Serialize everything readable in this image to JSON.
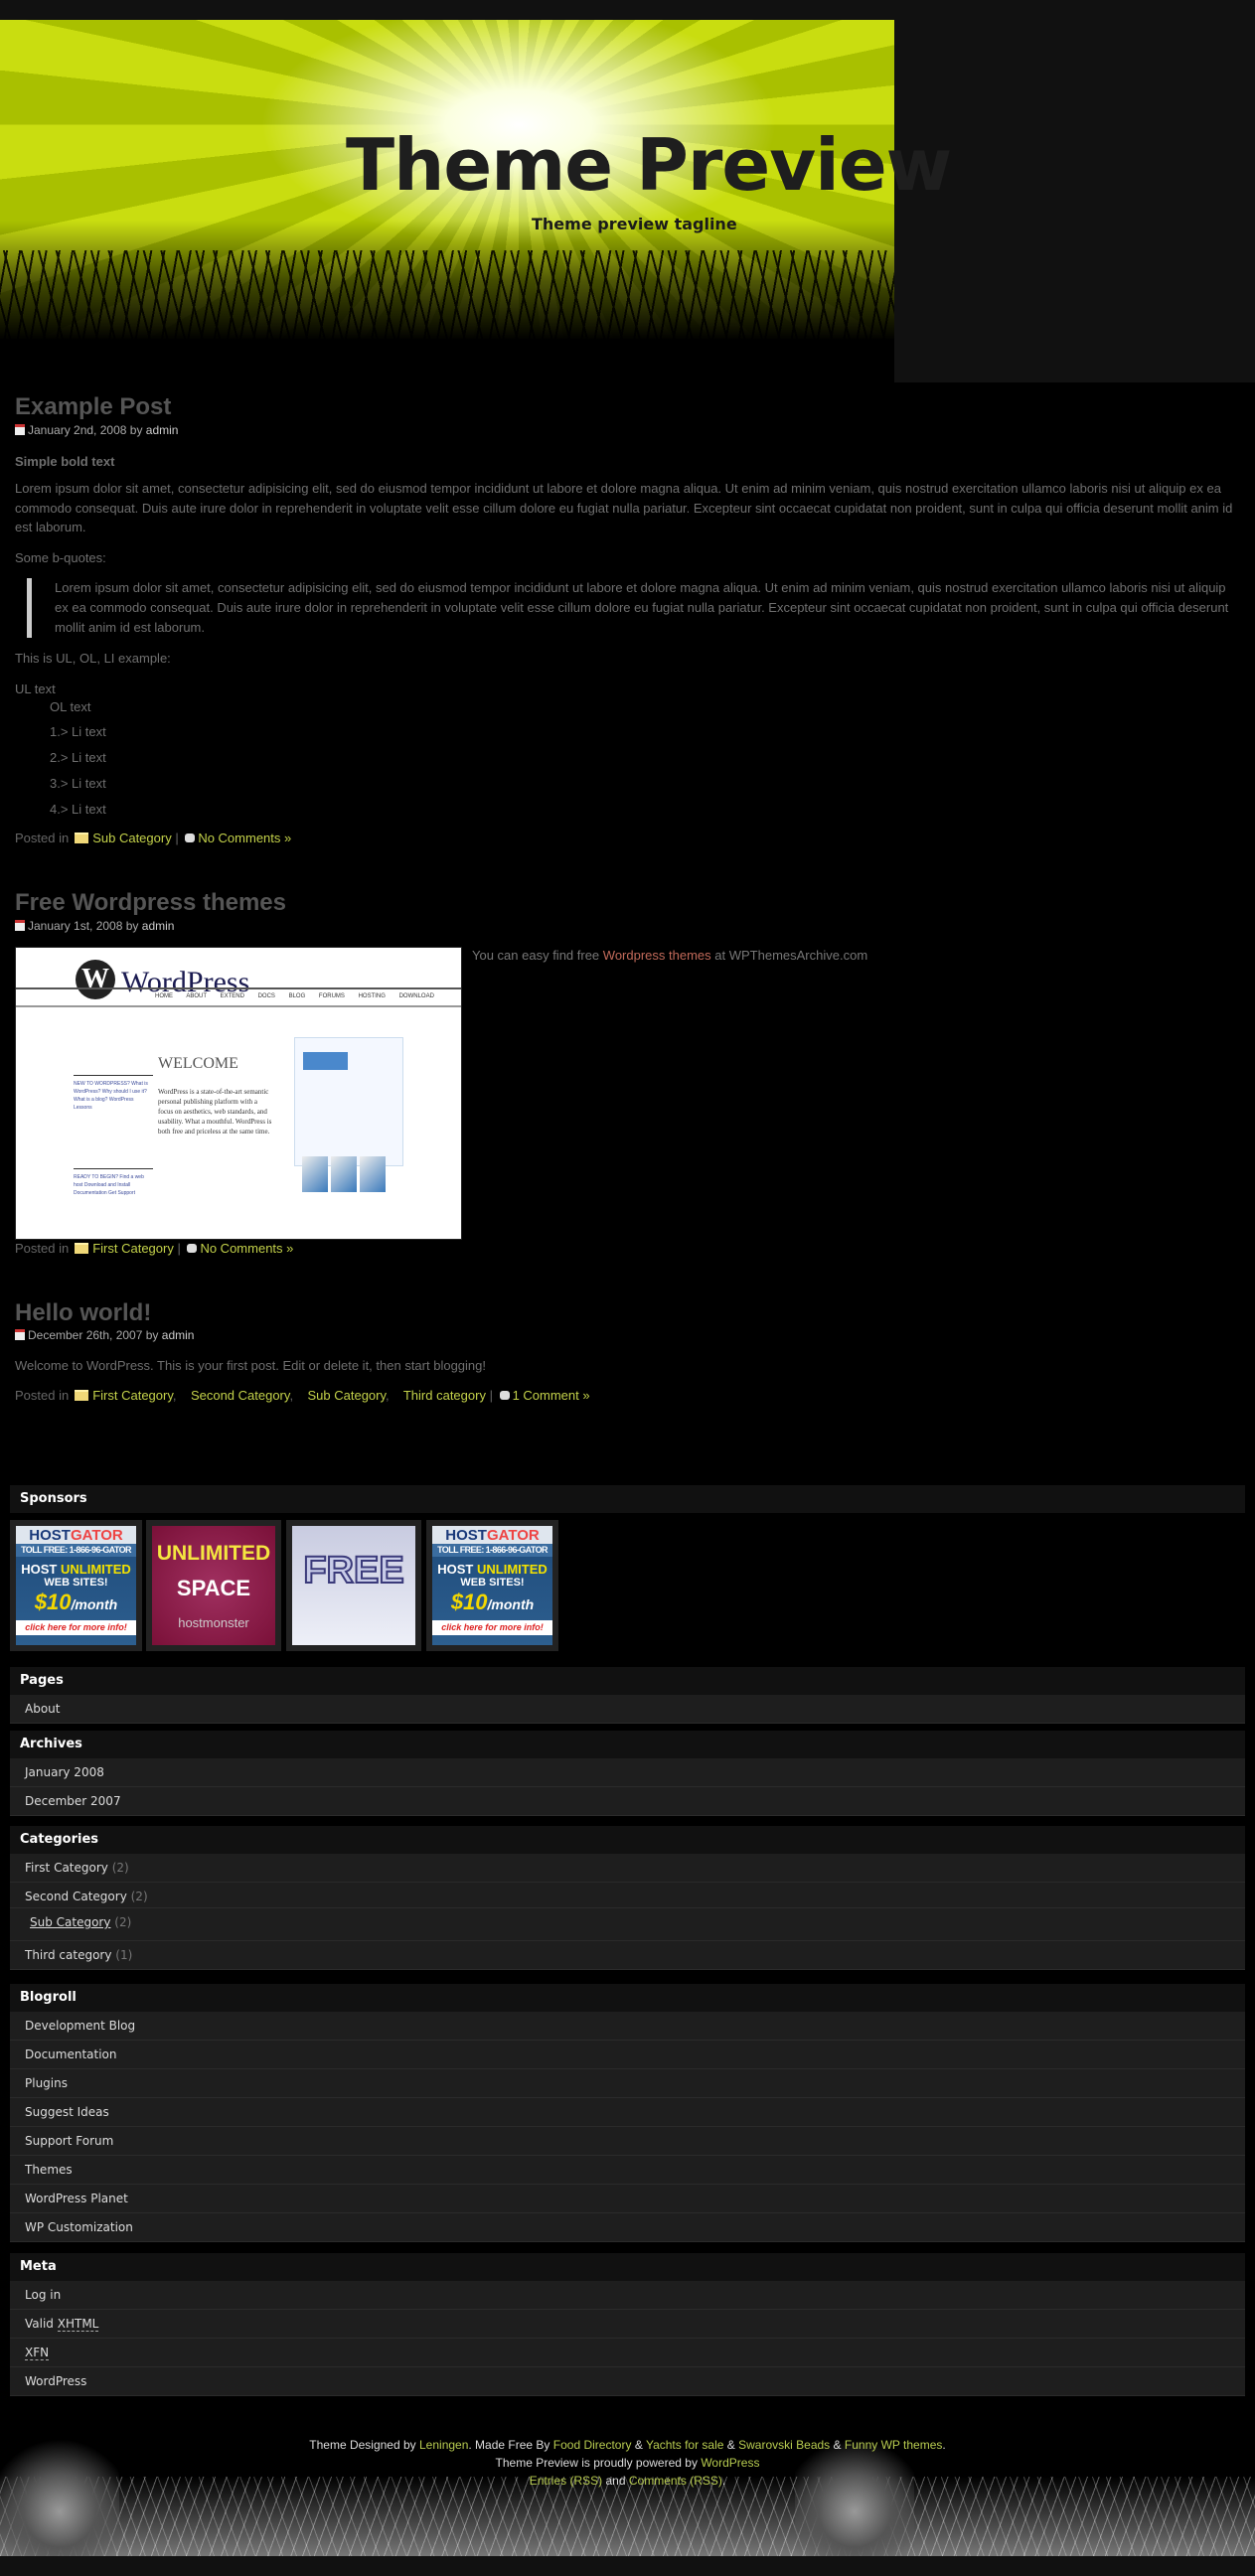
{
  "header": {
    "title": "Theme Preview",
    "tagline": "Theme preview tagline"
  },
  "posts": [
    {
      "title": "Example Post",
      "date": "January 2nd, 2008",
      "by": "by",
      "author": "admin",
      "bold_text": "Simple bold text",
      "paragraph": "Lorem ipsum dolor sit amet, consectetur adipisicing elit, sed do eiusmod tempor incididunt ut labore et dolore magna aliqua. Ut enim ad minim veniam, quis nostrud exercitation ullamco laboris nisi ut aliquip ex ea commodo consequat. Duis aute irure dolor in reprehenderit in voluptate velit esse cillum dolore eu fugiat nulla pariatur. Excepteur sint occaecat cupidatat non proident, sunt in culpa qui officia deserunt mollit anim id est laborum.",
      "bquote_intro": "Some b-quotes:",
      "blockquote": "Lorem ipsum dolor sit amet, consectetur adipisicing elit, sed do eiusmod tempor incididunt ut labore et dolore magna aliqua. Ut enim ad minim veniam, quis nostrud exercitation ullamco laboris nisi ut aliquip ex ea commodo consequat. Duis aute irure dolor in reprehenderit in voluptate velit esse cillum dolore eu fugiat nulla pariatur. Excepteur sint occaecat cupidatat non proident, sunt in culpa qui officia deserunt mollit anim id est laborum.",
      "list_intro": "This is UL, OL, LI example:",
      "ul_text": "UL text",
      "ol_text": "OL text",
      "li_items": [
        "1.> Li text",
        "2.> Li text",
        "3.> Li text",
        "4.> Li text"
      ],
      "posted_in": "Posted in",
      "categories": [
        "Sub Category"
      ],
      "comments": "No Comments »"
    },
    {
      "title": "Free Wordpress themes",
      "date": "January 1st, 2008",
      "by": "by",
      "author": "admin",
      "text_before": "You can easy find free",
      "link": "Wordpress themes",
      "text_after": "at WPThemesArchive.com",
      "image": {
        "logo_letter": "W",
        "logo_word": "WordPress",
        "nav": "HOME ABOUT EXTEND DOCS BLOG FORUMS HOSTING DOWNLOAD",
        "welcome": "WELCOME",
        "body": "WordPress is a state-of-the-art semantic personal publishing platform with a focus on aesthetics, web standards, and usability. What a mouthful. WordPress is both free and priceless at the same time.",
        "side1": "NEW TO WORDPRESS? What is WordPress? Why should I use it? What is a blog? WordPress Lessons",
        "side2": "READY TO BEGIN? Find a web host Download and Install Documentation Get Support"
      },
      "posted_in": "Posted in",
      "categories": [
        "First Category"
      ],
      "comments": "No Comments »"
    },
    {
      "title": "Hello world!",
      "date": "December 26th, 2007",
      "by": "by",
      "author": "admin",
      "paragraph": "Welcome to WordPress. This is your first post. Edit or delete it, then start blogging!",
      "posted_in": "Posted in",
      "categories": [
        "First Category",
        "Second Category",
        "Sub Category",
        "Third category"
      ],
      "comments": "1 Comment »"
    }
  ],
  "sponsors": {
    "title": "Sponsors",
    "banners": [
      {
        "brand1": "HOST",
        "brand2": "GATOR",
        "tollfree": "TOLL FREE: 1-866-96-GATOR",
        "host": "HOST",
        "unlimited": "UNLIMITED",
        "sites": "WEB SITES!",
        "price": "$10",
        "per": "/month",
        "cta": "click here for more info!"
      },
      {
        "line1": "UNLIMITED",
        "line2": "SPACE",
        "brand": "hostmonster"
      },
      {
        "line1": "FREE"
      },
      {
        "brand1": "HOST",
        "brand2": "GATOR",
        "tollfree": "TOLL FREE: 1-866-96-GATOR",
        "host": "HOST",
        "unlimited": "UNLIMITED",
        "sites": "WEB SITES!",
        "price": "$10",
        "per": "/month",
        "cta": "click here for more info!"
      }
    ]
  },
  "pages": {
    "title": "Pages",
    "items": [
      "About"
    ]
  },
  "archives": {
    "title": "Archives",
    "items": [
      "January 2008",
      "December 2007"
    ]
  },
  "categories": {
    "title": "Categories",
    "items": [
      {
        "name": "First Category",
        "count": "(2)"
      },
      {
        "name": "Second Category",
        "count": "(2)"
      },
      {
        "name": "Sub Category",
        "count": "(2)"
      },
      {
        "name": "Third category",
        "count": "(1)"
      }
    ]
  },
  "blogroll": {
    "title": "Blogroll",
    "items": [
      "Development Blog",
      "Documentation",
      "Plugins",
      "Suggest Ideas",
      "Support Forum",
      "Themes",
      "WordPress Planet",
      "WP Customization"
    ]
  },
  "meta": {
    "title": "Meta",
    "login": "Log in",
    "valid": "Valid",
    "xhtml": "XHTML",
    "xfn": "XFN",
    "wordpress": "WordPress"
  },
  "footer": {
    "designed_by": "Theme Designed by",
    "leningen": "Leningen",
    "made_free": ". Made Free By",
    "food": "Food Directory",
    "amp": "&",
    "yachts": "Yachts for sale",
    "beads": "Swarovski Beads",
    "funny": "Funny WP themes",
    "powered_pre": "Theme Preview is proudly powered by",
    "wordpress": "WordPress",
    "entries": "Entries (RSS)",
    "and": "and",
    "comments": "Comments (RSS)"
  },
  "colors": {
    "link": "#c4d24a",
    "accent_link": "#c26a5a",
    "background": "#000000",
    "widget_item": "#1e1e1e"
  }
}
